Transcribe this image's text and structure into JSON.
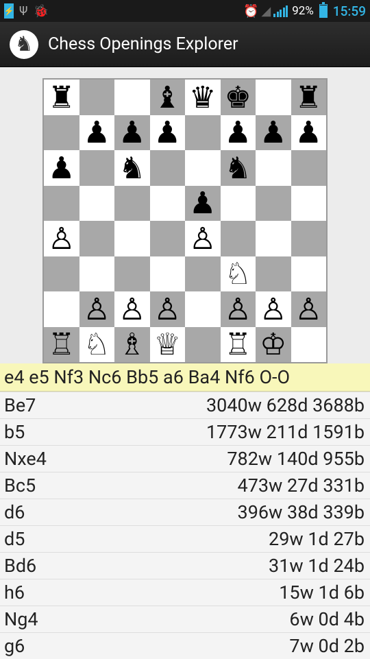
{
  "status": {
    "battery_pct": "92%",
    "time": "15:59"
  },
  "app": {
    "title": "Chess Openings Explorer"
  },
  "board": {
    "rows": [
      [
        "♜",
        "",
        "",
        "♝",
        "♛",
        "♚",
        "",
        "♜"
      ],
      [
        "",
        "♟",
        "♟",
        "♟",
        "",
        "♟",
        "♟",
        "♟"
      ],
      [
        "♟",
        "",
        "♞",
        "",
        "",
        "♞",
        "",
        ""
      ],
      [
        "",
        "",
        "",
        "",
        "♟",
        "",
        "",
        ""
      ],
      [
        "♙",
        "",
        "",
        "",
        "♙",
        "",
        "",
        ""
      ],
      [
        "",
        "",
        "",
        "",
        "",
        "♘",
        "",
        ""
      ],
      [
        "",
        "♙",
        "♙",
        "♙",
        "",
        "♙",
        "♙",
        "♙"
      ],
      [
        "♖",
        "♘",
        "♗",
        "♕",
        "",
        "♖",
        "♔",
        ""
      ]
    ]
  },
  "line": "e4 e5 Nf3 Nc6 Bb5 a6 Ba4 Nf6 O-O",
  "moves": [
    {
      "name": "Be7",
      "stats": "3040w 628d 3688b"
    },
    {
      "name": "b5",
      "stats": "1773w 211d 1591b"
    },
    {
      "name": "Nxe4",
      "stats": "782w 140d 955b"
    },
    {
      "name": "Bc5",
      "stats": "473w 27d 331b"
    },
    {
      "name": "d6",
      "stats": "396w 38d 339b"
    },
    {
      "name": "d5",
      "stats": "29w 1d 27b"
    },
    {
      "name": "Bd6",
      "stats": "31w 1d 24b"
    },
    {
      "name": "h6",
      "stats": "15w 1d 6b"
    },
    {
      "name": "Ng4",
      "stats": "6w 0d 4b"
    },
    {
      "name": "g6",
      "stats": "7w 0d 2b"
    }
  ]
}
